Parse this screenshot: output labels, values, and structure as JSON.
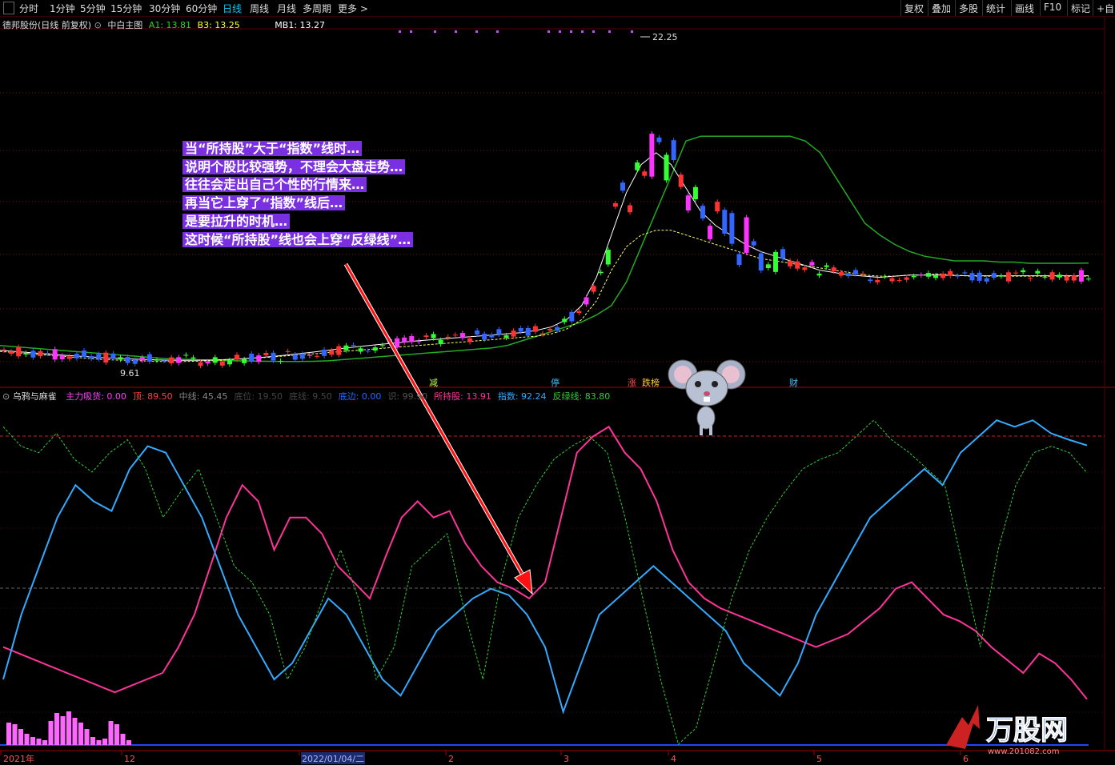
{
  "toolbar": {
    "periods": [
      "分时",
      "1分钟",
      "5分钟",
      "15分钟",
      "30分钟",
      "60分钟",
      "日线",
      "周线",
      "月线",
      "多周期",
      "更多 >"
    ],
    "active_period": "日线",
    "actions": [
      "复权",
      "叠加",
      "多股",
      "统计",
      "画线",
      "F10",
      "标记",
      "+自"
    ]
  },
  "main_panel": {
    "stock_title": "德邦股份(日线 前复权)",
    "indicator_name": "中白主图",
    "a1_label": "A1: 13.81",
    "b3_label": "B3: 13.25",
    "mb1_label": "MB1: 13.27",
    "high_label": "22.25",
    "low_label": "9.61",
    "signals": [
      {
        "text": "减",
        "color": "#b8ff40"
      },
      {
        "text": "停",
        "color": "#40c0ff"
      },
      {
        "text": "涨",
        "color": "#ff5050"
      },
      {
        "text": "跌榜",
        "color": "#ffcc33"
      },
      {
        "text": "财",
        "color": "#40c0ff"
      }
    ]
  },
  "sub_panel": {
    "name": "乌鸦与麻雀",
    "legend": [
      {
        "text": "主力吸货: 0.00",
        "color": "#ff40ff"
      },
      {
        "text": "顶: 89.50",
        "color": "#ff4040"
      },
      {
        "text": "中线: 45.45",
        "color": "#888888"
      },
      {
        "text": "底位: 19.50",
        "color": "#444444"
      },
      {
        "text": "底线: 9.50",
        "color": "#444444"
      },
      {
        "text": "底边: 0.00",
        "color": "#2266ff"
      },
      {
        "text": "识: 99.90",
        "color": "#555555"
      },
      {
        "text": "所持股: 13.91",
        "color": "#ff3399"
      },
      {
        "text": "指数: 92.24",
        "color": "#33aaff"
      },
      {
        "text": "反绿线: 83.80",
        "color": "#33cc33"
      }
    ]
  },
  "annotation": [
    "当“所持股”大于“指数”线时…",
    "说明个股比较强势，不理会大盘走势…",
    "往往会走出自己个性的行情来…",
    "再当它上穿了“指数”线后…",
    "是要拉升的时机…",
    "这时候“所持股”线也会上穿“反绿线”…"
  ],
  "date_axis": [
    "2021年",
    "12",
    "2022/01/04/二",
    "2",
    "3",
    "4",
    "5",
    "6"
  ],
  "logo": {
    "text": "万股网",
    "url_text": "www.201082.com"
  },
  "colors": {
    "up": "#ff3333",
    "down": "#3366ff",
    "green_up": "#33ff33",
    "pink": "#ff33ff",
    "index": "#33aaff",
    "holding": "#ff3399",
    "green_line": "#33cc33"
  },
  "chart_data": [
    {
      "type": "line",
      "title": "德邦股份(日线 前复权)",
      "ylim": [
        9.0,
        23.5
      ],
      "series": [
        {
          "name": "A1",
          "values": [
            10.3,
            10.25,
            10.2,
            10.15,
            10.1,
            10.05,
            10.0,
            9.95,
            9.9,
            9.85,
            9.8,
            9.75,
            9.72,
            9.7,
            9.68,
            9.66,
            9.65,
            9.64,
            9.63,
            9.62,
            9.62,
            9.63,
            9.65,
            9.7,
            9.75,
            9.8,
            9.85,
            9.9,
            9.95,
            10.0,
            10.05,
            10.1,
            10.15,
            10.2,
            10.3,
            10.5,
            10.7,
            10.9,
            11.1,
            11.3,
            11.6,
            12.0,
            13.0,
            14.5,
            16.0,
            17.5,
            19.0,
            19.2,
            19.2,
            19.2,
            19.2,
            19.2,
            19.2,
            19.2,
            19.0,
            18.5,
            17.5,
            16.5,
            15.5,
            15.0,
            14.6,
            14.3,
            14.1,
            14.0,
            13.9,
            13.9,
            13.9,
            13.85,
            13.85,
            13.8,
            13.8,
            13.8,
            13.8,
            13.81
          ]
        },
        {
          "name": "B3",
          "values": [
            10.05,
            10.0,
            9.95,
            9.9,
            9.85,
            9.8,
            9.75,
            9.7,
            9.68,
            9.66,
            9.64,
            9.62,
            9.62,
            9.63,
            9.65,
            9.68,
            9.72,
            9.76,
            9.8,
            9.85,
            9.9,
            9.95,
            10.0,
            10.05,
            10.1,
            10.15,
            10.2,
            10.25,
            10.3,
            10.35,
            10.4,
            10.45,
            10.5,
            10.55,
            10.6,
            10.65,
            10.7,
            10.8,
            11.0,
            11.4,
            12.2,
            13.5,
            14.5,
            15.0,
            15.2,
            15.2,
            15.0,
            14.8,
            14.6,
            14.4,
            14.2,
            14.0,
            13.9,
            13.8,
            13.7,
            13.6,
            13.5,
            13.4,
            13.3,
            13.25,
            13.25,
            13.3,
            13.3,
            13.35,
            13.3,
            13.25,
            13.25,
            13.25,
            13.25,
            13.25,
            13.25,
            13.25,
            13.25,
            13.25
          ]
        },
        {
          "name": "MB1",
          "values": [
            10.1,
            10.05,
            10.0,
            9.95,
            9.9,
            9.86,
            9.82,
            9.78,
            9.75,
            9.72,
            9.7,
            9.68,
            9.67,
            9.67,
            9.68,
            9.7,
            9.73,
            9.77,
            9.82,
            9.88,
            9.95,
            10.02,
            10.1,
            10.18,
            10.25,
            10.32,
            10.38,
            10.44,
            10.5,
            10.55,
            10.6,
            10.65,
            10.7,
            10.75,
            10.8,
            10.85,
            10.95,
            11.1,
            11.4,
            12.0,
            13.2,
            15.0,
            16.8,
            18.0,
            18.5,
            18.0,
            17.0,
            16.0,
            15.4,
            15.0,
            14.6,
            14.3,
            14.1,
            13.9,
            13.7,
            13.5,
            13.4,
            13.3,
            13.25,
            13.2,
            13.25,
            13.3,
            13.3,
            13.3,
            13.28,
            13.27,
            13.27,
            13.27,
            13.27,
            13.27,
            13.27,
            13.27,
            13.27,
            13.27
          ]
        }
      ],
      "annotations": [
        "22.25",
        "9.61"
      ]
    },
    {
      "type": "line",
      "title": "乌鸦与麻雀",
      "ylim": [
        0,
        105
      ],
      "series": [
        {
          "name": "所持股",
          "values": [
            30,
            28,
            26,
            24,
            22,
            20,
            18,
            16,
            18,
            20,
            22,
            30,
            40,
            55,
            70,
            80,
            75,
            60,
            70,
            70,
            65,
            55,
            50,
            45,
            58,
            70,
            75,
            70,
            72,
            62,
            55,
            50,
            48,
            45,
            50,
            70,
            90,
            95,
            98,
            90,
            85,
            75,
            60,
            50,
            45,
            42,
            40,
            38,
            36,
            34,
            32,
            30,
            32,
            34,
            38,
            42,
            48,
            50,
            45,
            40,
            38,
            35,
            30,
            26,
            22,
            28,
            25,
            20,
            13.91
          ]
        },
        {
          "name": "指数",
          "values": [
            20,
            40,
            55,
            70,
            80,
            75,
            72,
            85,
            92,
            90,
            80,
            70,
            55,
            40,
            30,
            20,
            25,
            35,
            45,
            40,
            30,
            20,
            15,
            25,
            35,
            40,
            45,
            48,
            46,
            40,
            30,
            10,
            25,
            40,
            45,
            50,
            55,
            50,
            45,
            40,
            35,
            25,
            20,
            15,
            25,
            40,
            50,
            60,
            70,
            75,
            80,
            85,
            80,
            90,
            95,
            100,
            98,
            100,
            96,
            94,
            92.24
          ]
        },
        {
          "name": "反绿线",
          "values": [
            98,
            92,
            90,
            96,
            88,
            84,
            90,
            94,
            85,
            70,
            78,
            85,
            70,
            55,
            50,
            40,
            20,
            30,
            45,
            60,
            45,
            20,
            30,
            55,
            60,
            65,
            40,
            20,
            50,
            70,
            80,
            88,
            92,
            95,
            90,
            70,
            45,
            20,
            0,
            5,
            25,
            45,
            60,
            70,
            78,
            85,
            88,
            90,
            95,
            100,
            94,
            90,
            85,
            80,
            55,
            30,
            60,
            80,
            90,
            92,
            90,
            83.8
          ]
        }
      ],
      "annotations": [
        "顶: 89.50",
        "中线: 45.45"
      ]
    }
  ]
}
